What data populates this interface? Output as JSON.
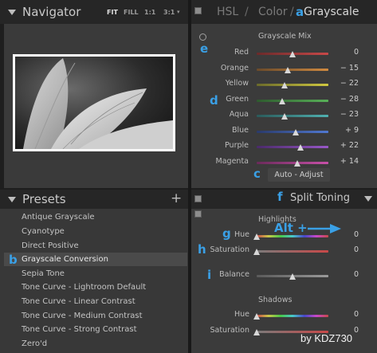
{
  "navigator": {
    "title": "Navigator",
    "zoom_options": [
      "FIT",
      "FILL",
      "1:1",
      "3:1"
    ]
  },
  "presets": {
    "title": "Presets",
    "add_symbol": "+",
    "items": [
      "Antique Grayscale",
      "Cyanotype",
      "Direct Positive",
      "Grayscale Conversion",
      "Sepia Tone",
      "Tone Curve - Lightroom Default",
      "Tone Curve - Linear Contrast",
      "Tone Curve - Medium Contrast",
      "Tone Curve - Strong Contrast",
      "Zero'd"
    ],
    "selected_index": 3
  },
  "hsl_panel": {
    "tabs": [
      "HSL",
      "/",
      "Color",
      "/",
      "Grayscale"
    ],
    "section_title": "Grayscale Mix",
    "sliders": [
      {
        "label": "Red",
        "value": "0",
        "pos": 0.5
      },
      {
        "label": "Orange",
        "value": "− 15",
        "pos": 0.43
      },
      {
        "label": "Yellow",
        "value": "− 22",
        "pos": 0.39
      },
      {
        "label": "Green",
        "value": "− 28",
        "pos": 0.36
      },
      {
        "label": "Aqua",
        "value": "− 23",
        "pos": 0.385
      },
      {
        "label": "Blue",
        "value": "+ 9",
        "pos": 0.545
      },
      {
        "label": "Purple",
        "value": "+ 22",
        "pos": 0.61
      },
      {
        "label": "Magenta",
        "value": "+ 14",
        "pos": 0.57
      }
    ],
    "auto_adjust": "Auto - Adjust"
  },
  "split_toning": {
    "title": "Split Toning",
    "highlights_title": "Highlights",
    "highlights": [
      {
        "label": "Hue",
        "value": "0",
        "pos": 0.0
      },
      {
        "label": "Saturation",
        "value": "0",
        "pos": 0.0
      }
    ],
    "balance": {
      "label": "Balance",
      "value": "0",
      "pos": 0.5
    },
    "shadows_title": "Shadows",
    "shadows": [
      {
        "label": "Hue",
        "value": "0",
        "pos": 0.0
      },
      {
        "label": "Saturation",
        "value": "0",
        "pos": 0.0
      }
    ]
  },
  "annotations": {
    "a": "a",
    "b": "b",
    "c": "c",
    "e": "e",
    "f": "f",
    "g": "g",
    "h": "h",
    "i": "i",
    "alt": "Alt +",
    "credit": "by KDZ730"
  },
  "colors": {
    "annotation": "#3aa0e6",
    "panel": "#3b3b3b",
    "header": "#262626"
  }
}
